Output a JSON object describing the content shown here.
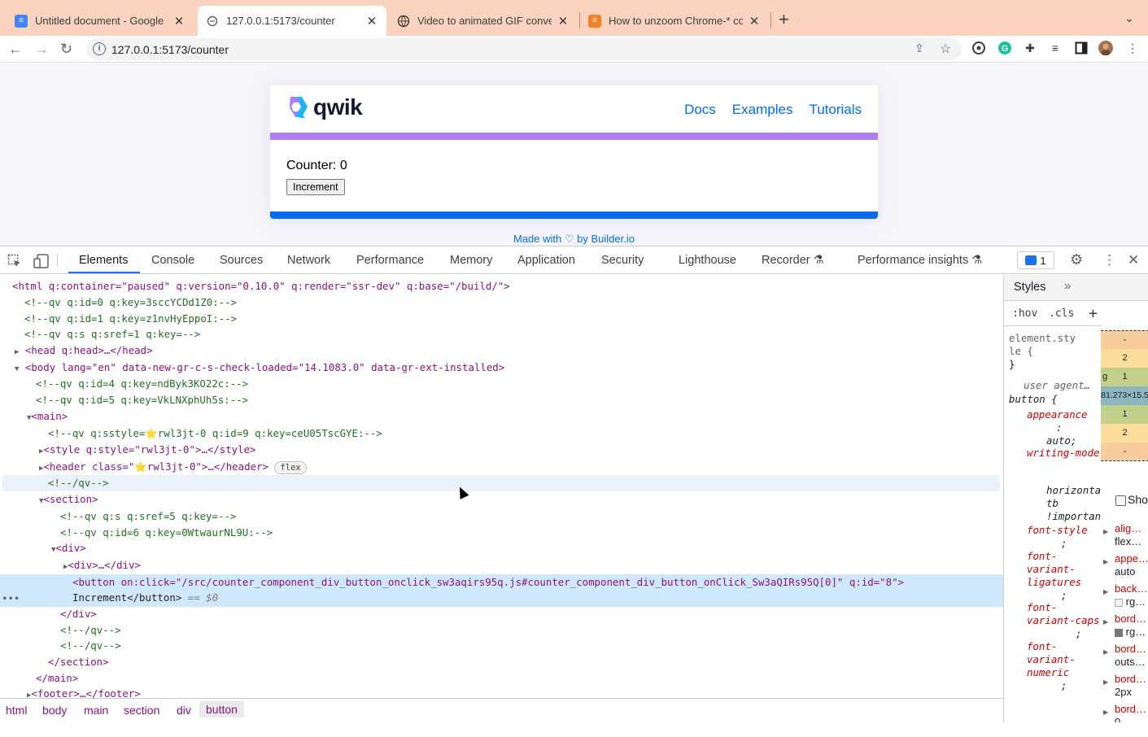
{
  "browser": {
    "tabs": [
      {
        "title": "Untitled document - Google Do"
      },
      {
        "title": "127.0.0.1:5173/counter"
      },
      {
        "title": "Video to animated GIF convert"
      },
      {
        "title": "How to unzoom Chrome-* con"
      }
    ],
    "url": "127.0.0.1:5173/counter"
  },
  "page": {
    "logo": "qwik",
    "nav": [
      "Docs",
      "Examples",
      "Tutorials"
    ],
    "counter_label": "Counter: 0",
    "button_label": "Increment",
    "footer_made": "Made with",
    "footer_by": "by Builder.io",
    "colors": {
      "accent_purple": "#ac7ef4",
      "accent_blue": "#006ce9",
      "text_dark": "#151934"
    }
  },
  "devtools": {
    "tabs": [
      "Elements",
      "Console",
      "Sources",
      "Network",
      "Performance",
      "Memory",
      "Application",
      "Security",
      "Lighthouse",
      "Recorder",
      "Performance insights"
    ],
    "issues_count": "1",
    "dom": {
      "l0": "<html q:container=\"paused\" q:version=\"0.10.0\" q:render=\"ssr-dev\" q:base=\"/build/\">",
      "l1": "<!--qv q:id=0 q:key=3sccYCDd1Z0:-->",
      "l2": "<!--qv q:id=1 q:key=z1nvHyEppoI:-->",
      "l3": "<!--qv q:s q:sref=1 q:key=-->",
      "l4": "<head q:head>…</head>",
      "l5": "<body lang=\"en\" data-new-gr-c-s-check-loaded=\"14.1083.0\" data-gr-ext-installed>",
      "l6": "<!--qv q:id=4 q:key=ndByk3KO22c:-->",
      "l7": "<!--qv q:id=5 q:key=VkLNXphUh5s:-->",
      "l8": "<main>",
      "l9": "<!--qv q:sstyle=⭐rwl3jt-0 q:id=9 q:key=ceU05TscGYE:-->",
      "l10": "<style q:style=\"rwl3jt-0\">…</style>",
      "l11": "<header class=\"⭐rwl3jt-0\">…</header>",
      "l11_badge": "flex",
      "l12": "<!--/qv-->",
      "l13": "<section>",
      "l14": "<!--qv q:s q:sref=5 q:key=-->",
      "l15": "<!--qv q:id=6 q:key=0WtwaurNL9U:-->",
      "l16": "<div>",
      "l17": "<div>…</div>",
      "l18": "<button on:click=\"/src/counter_component_div_button_onclick_sw3aqirs95q.js#counter_component_div_button_onClick_Sw3aQIRs95Q[0]\" q:id=\"8\">",
      "l19_text": "Increment</button>",
      "l19_eq": " == $0",
      "l20": "</div>",
      "l21": "<!--/qv-->",
      "l22": "<!--/qv-->",
      "l23": "</section>",
      "l24": "</main>",
      "l25": "<footer>…</footer>"
    },
    "breadcrumbs": [
      "html",
      "body",
      "main",
      "section",
      "div",
      "button"
    ],
    "styles": {
      "tab": "Styles",
      "hov": ":hov",
      "cls": ".cls",
      "element_style_1": "element.sty",
      "element_style_2": "le {",
      "brace": "}",
      "user_agent": "user agent…",
      "selector": "button {",
      "props": [
        {
          "name": "appearance",
          "value": "auto;"
        },
        {
          "name": "writing-mode",
          "value": "horizontal-tb !important"
        },
        {
          "name": "font-style",
          "value": ";"
        },
        {
          "name": "font-variant-ligatures",
          "value": ";"
        },
        {
          "name": "font-variant-caps",
          "value": ";"
        },
        {
          "name": "font-variant-numeric",
          "value": ";"
        }
      ],
      "boxmodel": [
        "-",
        "2",
        "1",
        "81.273×15.5",
        "1",
        "2",
        "-"
      ],
      "boxmodel_side": "g",
      "show_all": "Sho",
      "computed": [
        {
          "name": "alig…",
          "value": "flex…"
        },
        {
          "name": "appe…",
          "value": "auto"
        },
        {
          "name": "back…",
          "value": "rg…"
        },
        {
          "name": "bord…",
          "value": "rg…"
        },
        {
          "name": "bord…",
          "value": "outs…"
        },
        {
          "name": "bord…",
          "value": "2px"
        },
        {
          "name": "bord…",
          "value": "0"
        }
      ]
    }
  }
}
